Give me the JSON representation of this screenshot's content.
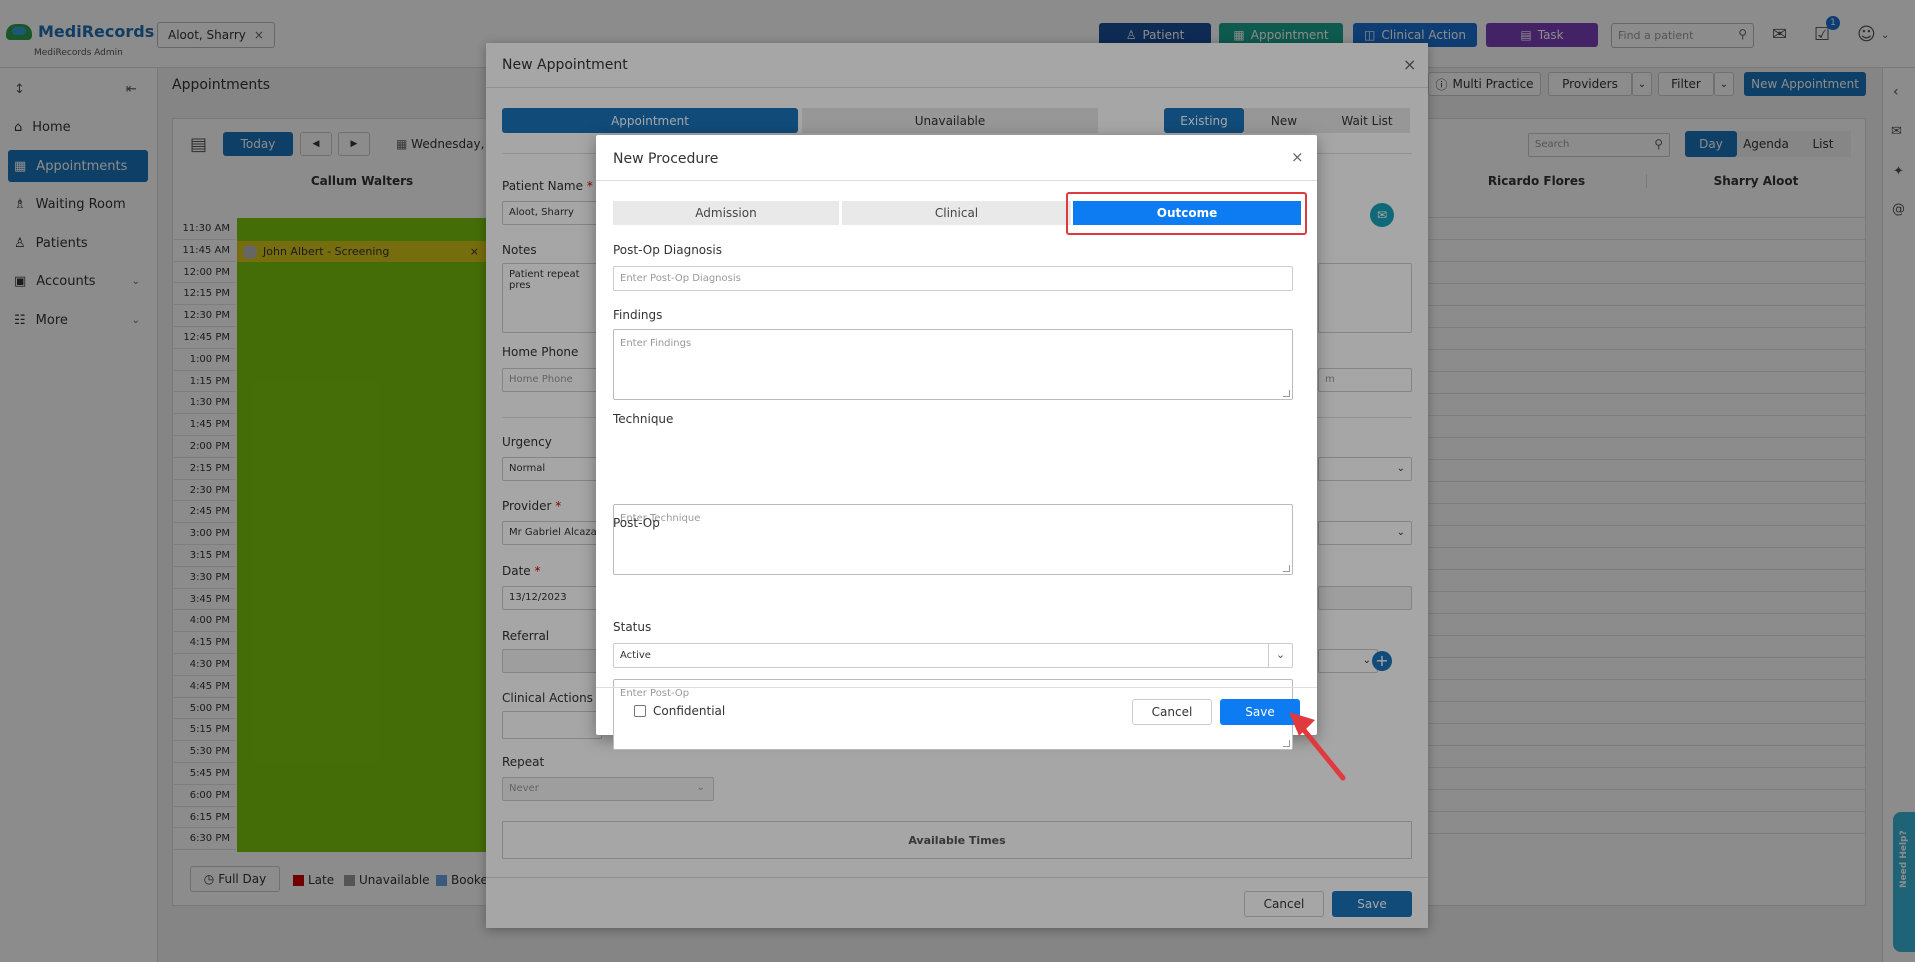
{
  "header": {
    "logo": "MediRecords",
    "logo_sub": "MediRecords Admin",
    "patient_chip": "Aloot, Sharry",
    "buttons": [
      {
        "label": "Patient",
        "color": "#1b4f9a"
      },
      {
        "label": "Appointment",
        "color": "#1aa58f"
      },
      {
        "label": "Clinical Action",
        "color": "#1b6fd1"
      },
      {
        "label": "Task",
        "color": "#7b3fb8"
      }
    ],
    "find_placeholder": "Find a patient",
    "notification_count": "1"
  },
  "sidebar": {
    "items": [
      {
        "label": "Home",
        "icon": "home-icon"
      },
      {
        "label": "Appointments",
        "icon": "calendar-icon"
      },
      {
        "label": "Waiting Room",
        "icon": "waiting-room-icon"
      },
      {
        "label": "Patients",
        "icon": "patients-icon"
      },
      {
        "label": "Accounts",
        "icon": "folder-icon"
      },
      {
        "label": "More",
        "icon": "more-icon"
      }
    ]
  },
  "appointments_page": {
    "title": "Appointments",
    "today": "Today",
    "date": "Wednesday,",
    "toolbar": {
      "multi_practice": "Multi Practice",
      "providers": "Providers",
      "filter": "Filter",
      "new_appointment": "New Appointment"
    },
    "search_placeholder": "Search",
    "views": [
      "Day",
      "Agenda",
      "List"
    ],
    "columns": [
      "Callum Walters",
      "Ricardo Flores",
      "Sharry Aloot"
    ],
    "times": [
      "11:30 AM",
      "11:45 AM",
      "12:00 PM",
      "12:15 PM",
      "12:30 PM",
      "12:45 PM",
      "1:00 PM",
      "1:15 PM",
      "1:30 PM",
      "1:45 PM",
      "2:00 PM",
      "2:15 PM",
      "2:30 PM",
      "2:45 PM",
      "3:00 PM",
      "3:15 PM",
      "3:30 PM",
      "3:45 PM",
      "4:00 PM",
      "4:15 PM",
      "4:30 PM",
      "4:45 PM",
      "5:00 PM",
      "5:15 PM",
      "5:30 PM",
      "5:45 PM",
      "6:00 PM",
      "6:15 PM",
      "6:30 PM"
    ],
    "appointment_bar": "John Albert - Screening",
    "legend": {
      "full_day": "Full Day",
      "late": "Late",
      "unavailable": "Unavailable",
      "booked": "Booke"
    }
  },
  "new_appointment": {
    "title": "New Appointment",
    "tabs": [
      "Appointment",
      "Unavailable"
    ],
    "mode_tabs": [
      "Existing",
      "New",
      "Wait List"
    ],
    "patient_name_label": "Patient Name",
    "patient_name_value": "Aloot, Sharry",
    "notes_label": "Notes",
    "notes_value": "Patient repeat pres",
    "home_phone_label": "Home Phone",
    "home_phone_placeholder": "Home Phone",
    "urgency_label": "Urgency",
    "urgency_value": "Normal",
    "provider_label": "Provider",
    "provider_value": "Mr Gabriel Alcazar",
    "date_label": "Date",
    "date_value": "13/12/2023",
    "referral_label": "Referral",
    "clinical_actions_label": "Clinical Actions",
    "repeat_label": "Repeat",
    "repeat_value": "Never",
    "right_field_partial": "m",
    "available_times": "Available Times",
    "cancel": "Cancel",
    "save": "Save"
  },
  "new_procedure": {
    "title": "New Procedure",
    "tabs": [
      "Admission",
      "Clinical",
      "Outcome"
    ],
    "active_tab": "Outcome",
    "post_op_diagnosis_label": "Post-Op Diagnosis",
    "post_op_diagnosis_placeholder": "Enter Post-Op Diagnosis",
    "findings_label": "Findings",
    "findings_placeholder": "Enter Findings",
    "technique_label": "Technique",
    "technique_placeholder": "Enter Technique",
    "post_op_label": "Post-Op",
    "post_op_placeholder": "Enter Post-Op",
    "status_label": "Status",
    "status_value": "Active",
    "confidential_label": "Confidential",
    "cancel": "Cancel",
    "save": "Save"
  },
  "help_tab": "Need Help?",
  "colors": {
    "primary": "#0d7bf2",
    "highlight": "#e0393e",
    "green_availability": "#7dc60f",
    "appointment_bar": "#d8c61a"
  }
}
